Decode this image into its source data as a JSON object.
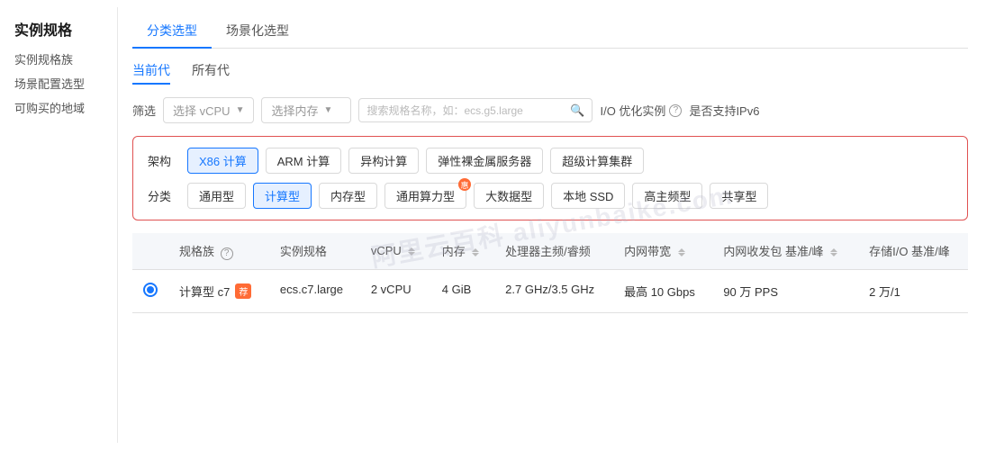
{
  "sidebar": {
    "title": "实例规格",
    "items": [
      {
        "label": "实例规格族"
      },
      {
        "label": "场景配置选型"
      },
      {
        "label": "可购买的地域"
      }
    ]
  },
  "topTabs": [
    {
      "label": "分类选型",
      "active": true
    },
    {
      "label": "场景化选型",
      "active": false
    }
  ],
  "genTabs": [
    {
      "label": "当前代",
      "active": true
    },
    {
      "label": "所有代",
      "active": false
    }
  ],
  "filter": {
    "label": "筛选",
    "vcpu": "选择 vCPU",
    "memory": "选择内存",
    "searchPlaceholder": "搜索规格名称，如：ecs.g5.large",
    "ioLabel": "I/O 优化实例",
    "ipv6Label": "是否支持IPv6"
  },
  "arch": {
    "archLabel": "架构",
    "categoryLabel": "分类",
    "archTags": [
      {
        "label": "X86 计算",
        "active": true
      },
      {
        "label": "ARM 计算",
        "active": false
      },
      {
        "label": "异构计算",
        "active": false
      },
      {
        "label": "弹性裸金属服务器",
        "active": false
      },
      {
        "label": "超级计算集群",
        "active": false
      }
    ],
    "categoryTags": [
      {
        "label": "通用型",
        "active": false,
        "badge": false
      },
      {
        "label": "计算型",
        "active": true,
        "badge": false
      },
      {
        "label": "内存型",
        "active": false,
        "badge": false
      },
      {
        "label": "通用算力型",
        "active": false,
        "badge": true
      },
      {
        "label": "大数据型",
        "active": false,
        "badge": false
      },
      {
        "label": "本地 SSD",
        "active": false,
        "badge": false
      },
      {
        "label": "高主频型",
        "active": false,
        "badge": false
      },
      {
        "label": "共享型",
        "active": false,
        "badge": false
      }
    ]
  },
  "table": {
    "columns": [
      {
        "label": ""
      },
      {
        "label": "规格族",
        "help": true
      },
      {
        "label": "实例规格"
      },
      {
        "label": "vCPU",
        "sort": true
      },
      {
        "label": "内存",
        "sort": true
      },
      {
        "label": "处理器主频/睿频"
      },
      {
        "label": "内网带宽",
        "sort": true
      },
      {
        "label": "内网收发包 基准/峰",
        "sort": true
      },
      {
        "label": "存储I/O 基准/峰"
      }
    ],
    "rows": [
      {
        "selected": true,
        "family": "计算型 c7",
        "familyBadge": "荐",
        "spec": "ecs.c7.large",
        "vcpu": "2 vCPU",
        "memory": "4 GiB",
        "freq": "2.7 GHz/3.5 GHz",
        "bandwidth": "最高 10 Gbps",
        "pps": "90 万 PPS",
        "storage": "2 万/1"
      }
    ]
  }
}
